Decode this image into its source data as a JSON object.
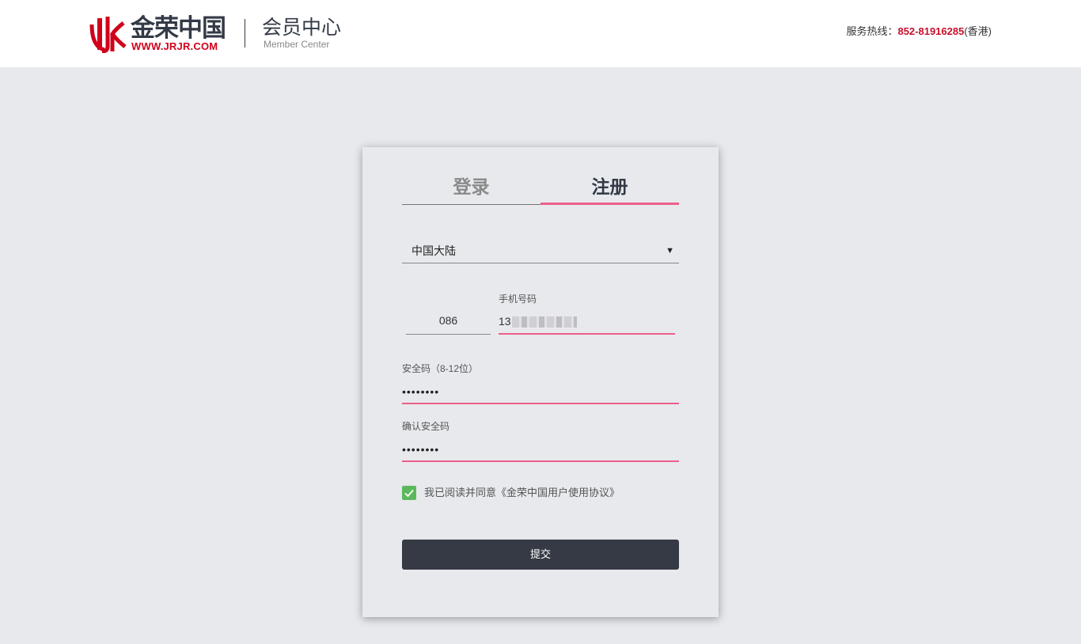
{
  "header": {
    "brand_name": "金荣中国",
    "brand_url": "WWW.JRJR.COM",
    "section_title": "会员中心",
    "section_subtitle": "Member Center",
    "hotline_label": "服务热线：",
    "hotline_number": "852-81916285",
    "hotline_region": "(香港)",
    "brand_color": "#d0021b"
  },
  "form": {
    "tabs": {
      "login": "登录",
      "register": "注册",
      "active": "register"
    },
    "region_select": {
      "value": "中国大陆",
      "arrow": "▼"
    },
    "country_code": "086",
    "phone_label": "手机号码",
    "phone_value_prefix": "13",
    "password_label": "安全码（8-12位）",
    "password_value": "••••••••",
    "confirm_label": "确认安全码",
    "confirm_value": "••••••••",
    "agreement_text": "我已阅读并同意《金荣中国用户使用协议》",
    "agreement_checked": true,
    "submit_label": "提交",
    "accent_color": "#ec5f8a",
    "button_color": "#363a45"
  }
}
